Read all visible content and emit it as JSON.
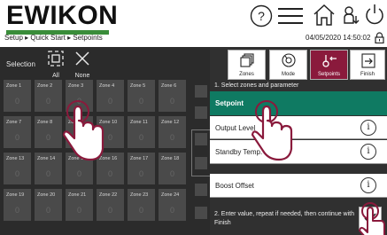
{
  "header": {
    "logo_text": "EWIKON",
    "breadcrumb": "Setup ▸ Quick Start ▸ Setpoints",
    "datetime": "04/05/2020 14:50:02",
    "icons": [
      "help-icon",
      "menu-icon",
      "home-icon",
      "user-logout-icon",
      "power-icon",
      "lock-icon"
    ]
  },
  "selection": {
    "label": "Selection",
    "all_label": "All",
    "none_label": "None"
  },
  "zones": [
    {
      "name": "Zone 1",
      "value": "0"
    },
    {
      "name": "Zone 2",
      "value": "0"
    },
    {
      "name": "Zone 3",
      "value": "0"
    },
    {
      "name": "Zone 4",
      "value": "0"
    },
    {
      "name": "Zone 5",
      "value": "0"
    },
    {
      "name": "Zone 6",
      "value": "0"
    },
    {
      "name": "Zone 7",
      "value": "0"
    },
    {
      "name": "Zone 8",
      "value": "0"
    },
    {
      "name": "Zone 9",
      "value": "0"
    },
    {
      "name": "Zone 10",
      "value": "0"
    },
    {
      "name": "Zone 11",
      "value": "0"
    },
    {
      "name": "Zone 12",
      "value": "0"
    },
    {
      "name": "Zone 13",
      "value": "0"
    },
    {
      "name": "Zone 14",
      "value": "0"
    },
    {
      "name": "Zone 15",
      "value": "0"
    },
    {
      "name": "Zone 16",
      "value": "0"
    },
    {
      "name": "Zone 17",
      "value": "0"
    },
    {
      "name": "Zone 18",
      "value": "0"
    },
    {
      "name": "Zone 19",
      "value": "0"
    },
    {
      "name": "Zone 20",
      "value": "0"
    },
    {
      "name": "Zone 21",
      "value": "0"
    },
    {
      "name": "Zone 22",
      "value": "0"
    },
    {
      "name": "Zone 23",
      "value": "0"
    },
    {
      "name": "Zone 24",
      "value": "0"
    }
  ],
  "tabs": [
    {
      "label": "Zones",
      "icon": "zones-icon",
      "active": false
    },
    {
      "label": "Mode",
      "icon": "mode-icon",
      "active": false
    },
    {
      "label": "Setpoints",
      "icon": "setpoints-icon",
      "active": true
    },
    {
      "label": "Finish",
      "icon": "finish-icon",
      "active": false
    }
  ],
  "instructions": {
    "step1": "1. Select zones and parameter",
    "step2": "2. Enter value, repeat if needed, then continue with Finish"
  },
  "setpoint_header": "Setpoint",
  "params": [
    {
      "label": "Output Level"
    },
    {
      "label": "Standby Temp."
    },
    {
      "label": "Boost Offset"
    }
  ],
  "colors": {
    "brand_green": "#3a8d3a",
    "accent_red": "#8a1a3c",
    "setpoint_green": "#0f7a62",
    "panel_dark": "#2b2b2b"
  }
}
